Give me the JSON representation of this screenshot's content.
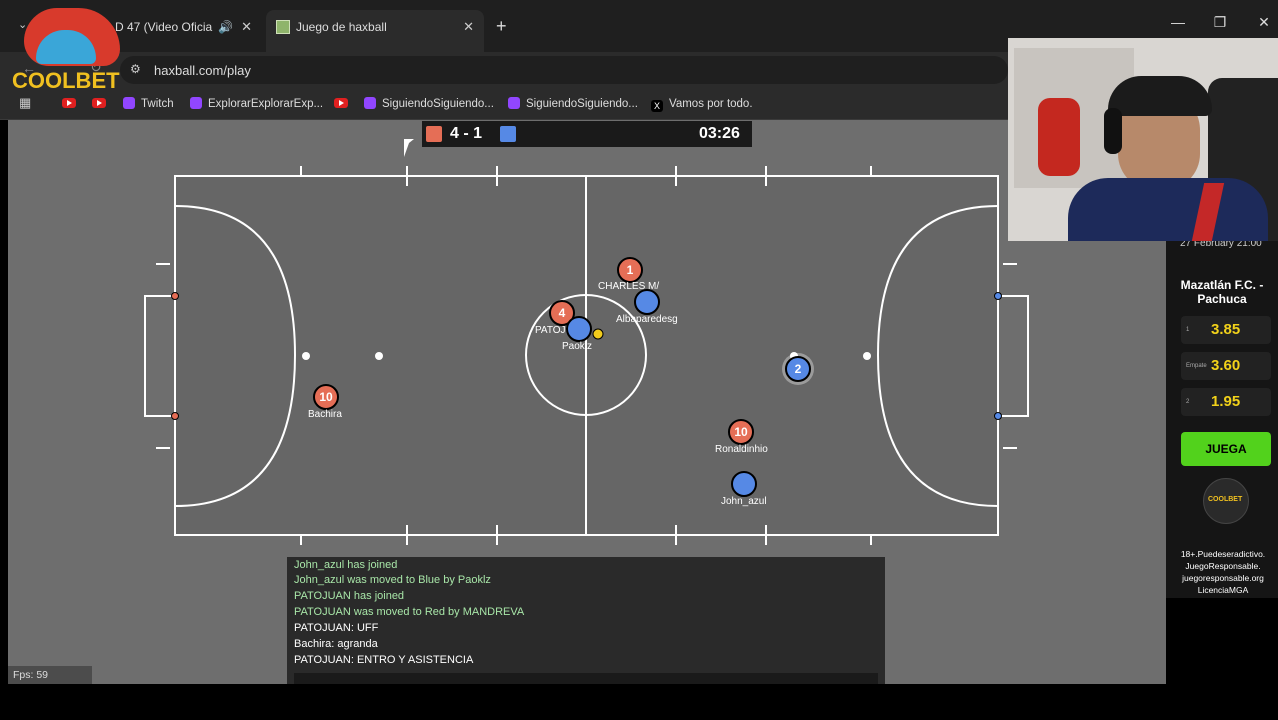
{
  "browser": {
    "tabs": [
      {
        "label": "D 47 (Video Oficia",
        "audio": true
      },
      {
        "label": "Juego de haxball",
        "active": true
      }
    ],
    "url": "haxball.com/play",
    "bookmarks": [
      "Twitch",
      "ExplorarExplorarExp...",
      "SiguiendoSiguiendo...",
      "SiguiendoSiguiendo...",
      "Vamos por todo."
    ]
  },
  "overlay_logo": "COOLBET",
  "scoreboard": {
    "red_score": "4 - 1",
    "timer": "03:26",
    "red_color": "#e56e56",
    "blue_color": "#5689e5"
  },
  "players": [
    {
      "label": "1",
      "name": "CHARLES M/",
      "team": "red"
    },
    {
      "label": "4",
      "name": "PATOJUAN",
      "team": "red"
    },
    {
      "label": "10",
      "name": "Bachira",
      "team": "red"
    },
    {
      "label": "10",
      "name": "Ronaldinhio",
      "team": "red"
    },
    {
      "label": "",
      "name": "Albaparedesg",
      "team": "blue"
    },
    {
      "label": "",
      "name": "Paoklz",
      "team": "blue"
    },
    {
      "label": "2",
      "name": "",
      "team": "blue"
    },
    {
      "label": "",
      "name": "John_azul",
      "team": "blue"
    }
  ],
  "chat": {
    "lines": [
      {
        "text": "John_azul has joined",
        "type": "system"
      },
      {
        "text": "John_azul was moved to Blue by Paoklz",
        "type": "system"
      },
      {
        "text": "PATOJUAN has joined",
        "type": "system"
      },
      {
        "text": "PATOJUAN was moved to Red by MANDREVA",
        "type": "system"
      },
      {
        "text": "PATOJUAN: UFF",
        "type": "msg"
      },
      {
        "text": "Bachira: agranda",
        "type": "msg"
      },
      {
        "text": "PATOJUAN: ENTRO Y ASISTENCIA",
        "type": "msg"
      }
    ]
  },
  "fps": "Fps: 59",
  "ad": {
    "date": "27 February 21:00",
    "match": "Mazatlán F.C. - Pachuca",
    "odds": [
      {
        "key": "1",
        "value": "3.85"
      },
      {
        "key": "Empate",
        "value": "3.60"
      },
      {
        "key": "2",
        "value": "1.95"
      }
    ],
    "cta": "JUEGA",
    "logo": "COOLBET",
    "disclaimer": "18+.Puedeseradictivo. JuegoResponsable. juegoresponsable.org LicenciaMGA"
  }
}
